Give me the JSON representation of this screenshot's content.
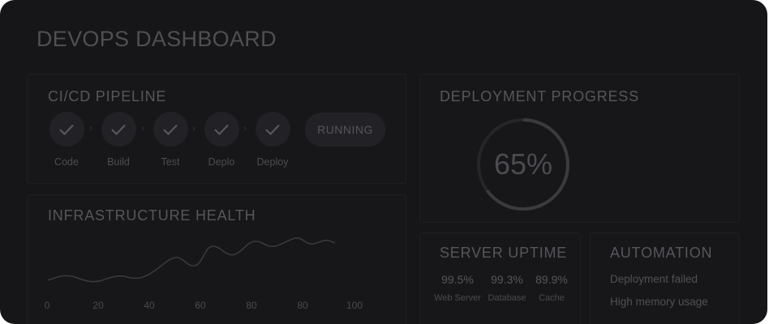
{
  "dashboard": {
    "title": "DEVOPS DASHBOARD"
  },
  "pipeline": {
    "title": "CI/CD PIPELINE",
    "stages": [
      {
        "label": "Code",
        "status": "done",
        "icon": "check-icon"
      },
      {
        "label": "Build",
        "status": "done",
        "icon": "check-icon"
      },
      {
        "label": "Test",
        "status": "done",
        "icon": "check-icon"
      },
      {
        "label": "Deplo",
        "status": "done",
        "icon": "check-icon"
      },
      {
        "label": "Deploy",
        "status": "done",
        "icon": "check-icon"
      }
    ],
    "arrow_icon": "chevron-right-icon",
    "status": "RUNNING"
  },
  "infrastructure": {
    "title": "INFRASTRUCTURE HEALTH",
    "x_ticks": [
      "0",
      "20",
      "40",
      "60",
      "80",
      "80",
      "100"
    ]
  },
  "deployment": {
    "title": "DEPLOYMENT PROGRESS",
    "progress_text": "65%",
    "progress_fraction": 0.65
  },
  "uptime": {
    "title": "SERVER UPTIME",
    "items": [
      {
        "value": "99.5%",
        "label": "Web Server"
      },
      {
        "value": "99.3%",
        "label": "Database"
      },
      {
        "value": "89.9%",
        "label": "Cache"
      }
    ]
  },
  "automation": {
    "title": "AUTOMATION",
    "alerts": [
      "Deployment failed",
      "High memory usage"
    ]
  },
  "colors": {
    "background": "#161618",
    "panel": "#17171a",
    "text": "#56565b",
    "chart_line": "#3a3a3f",
    "progress_track": "#262629",
    "progress_fill": "#3a3a3f"
  }
}
